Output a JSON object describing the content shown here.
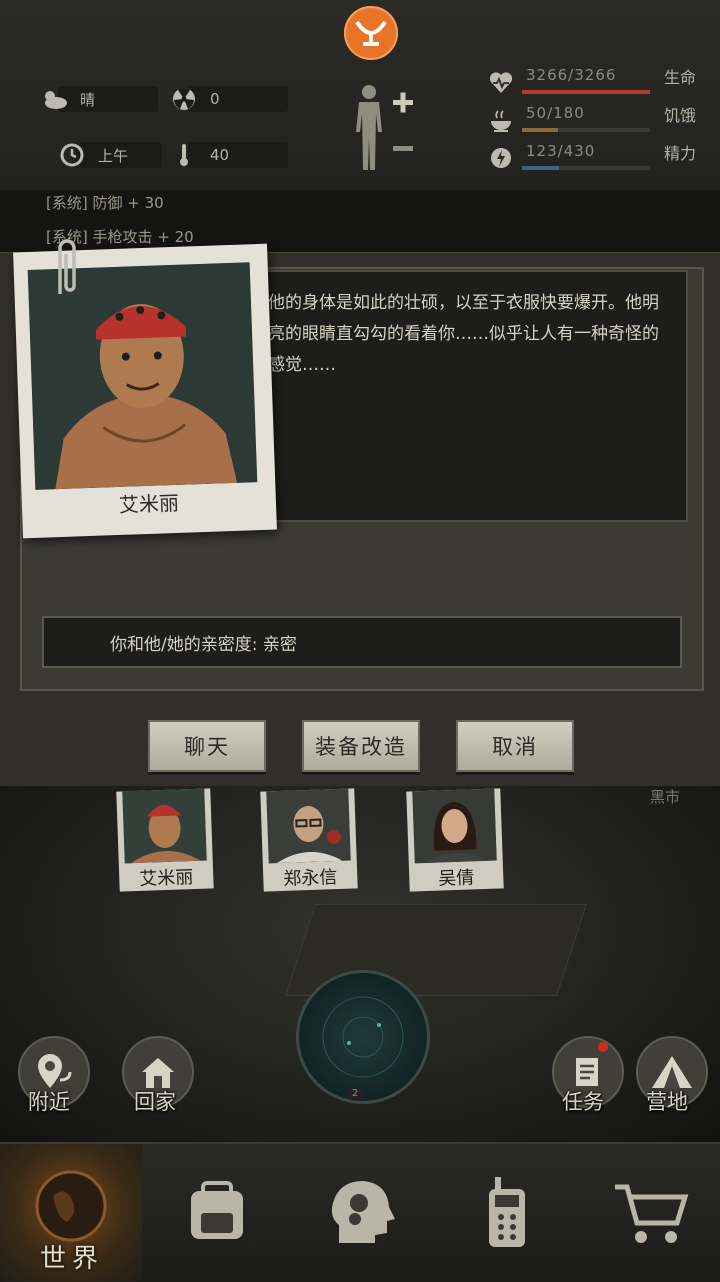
{
  "status": {
    "weather": "晴",
    "radiation": "0",
    "time_of_day": "上午",
    "temperature": "40"
  },
  "vitals": [
    {
      "label": "生命",
      "value": "3266/3266",
      "current": 3266,
      "max": 3266,
      "color": "#b33a34"
    },
    {
      "label": "饥饿",
      "value": "50/180",
      "current": 50,
      "max": 180,
      "color": "#8c6a3a"
    },
    {
      "label": "精力",
      "value": "123/430",
      "current": 123,
      "max": 430,
      "color": "#3f5f8c"
    }
  ],
  "log": [
    "[系统] 防御 + 30",
    "[系统] 手枪攻击 + 20"
  ],
  "dialog": {
    "character_name": "艾米丽",
    "description": "他的身体是如此的壮硕，以至于衣服快要爆开。他明亮的眼睛直勾勾的看着你……似乎让人有一种奇怪的感觉……",
    "affinity": "你和他/她的亲密度: 亲密",
    "buttons": {
      "chat": "聊天",
      "equip_modify": "装备改造",
      "cancel": "取消"
    }
  },
  "scene": {
    "market_label": "黑市",
    "npcs": [
      "艾米丽",
      "郑永信",
      "吴倩"
    ],
    "radar_count": "2",
    "actions": {
      "nearby": "附近",
      "home": "回家",
      "tasks": "任务",
      "camp": "营地"
    }
  },
  "nav": {
    "world": "世界"
  },
  "colors": {
    "accent_orange": "#e8742a",
    "button_face": "#c8c5b6",
    "panel_dark": "#1d1d1a"
  }
}
